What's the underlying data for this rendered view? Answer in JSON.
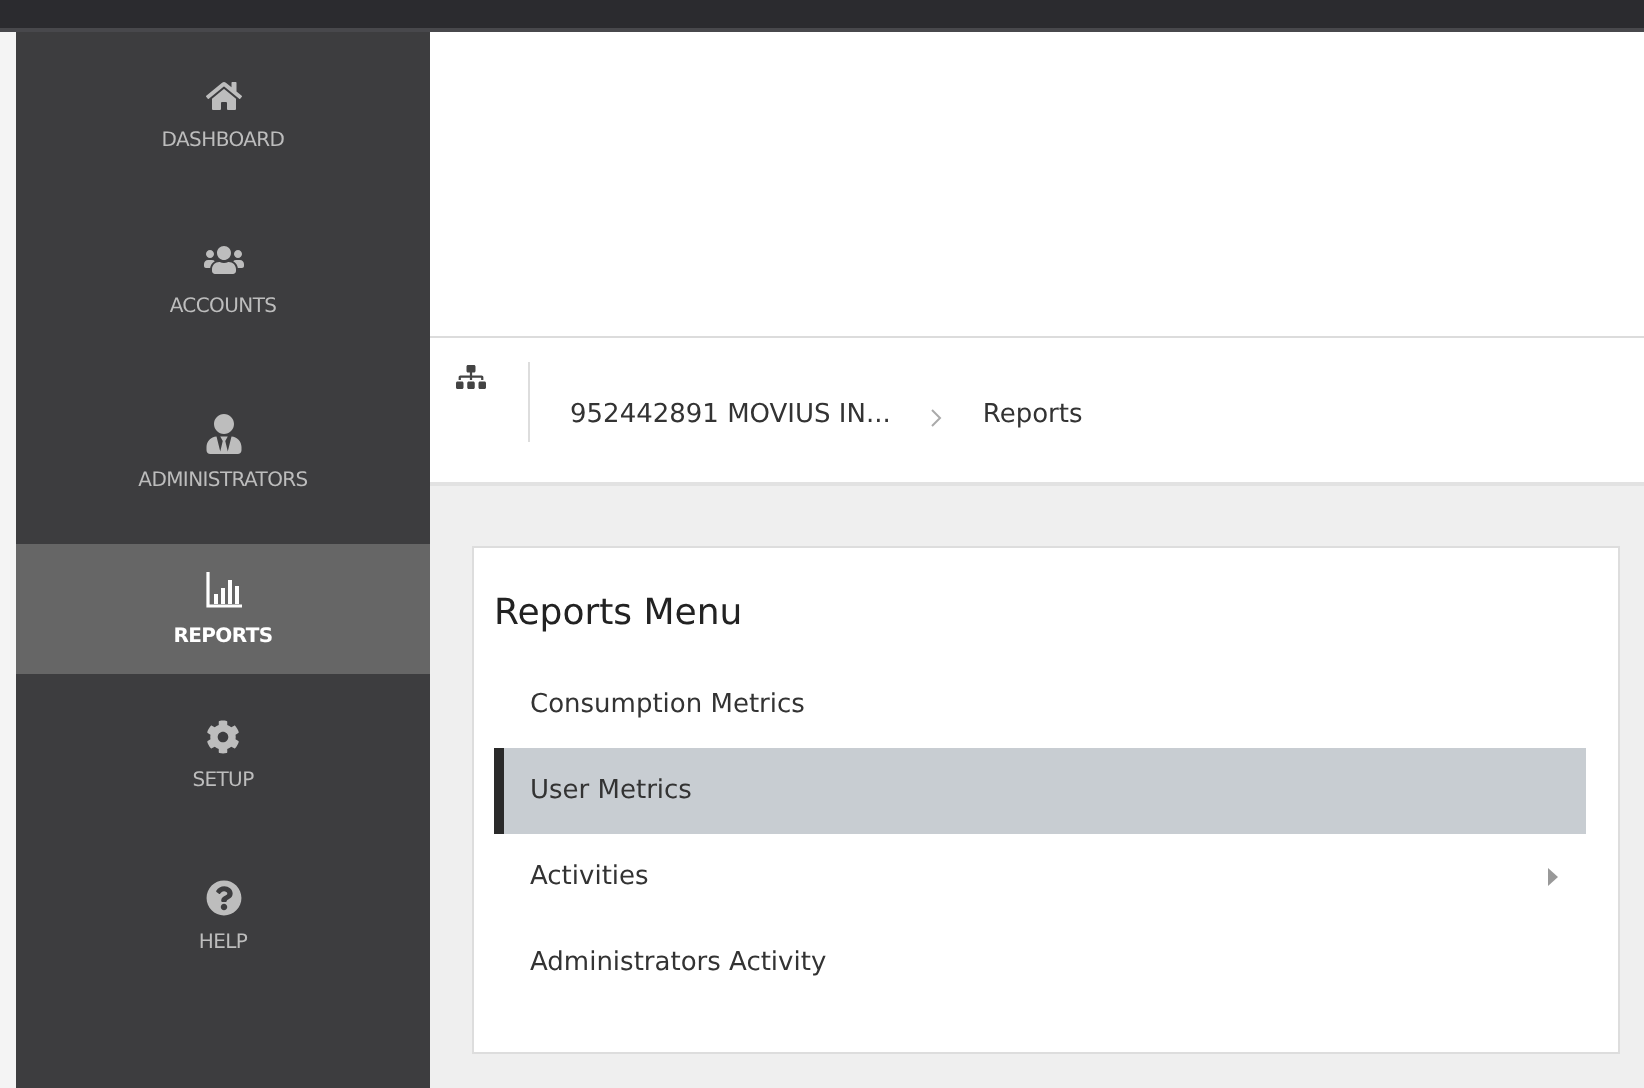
{
  "sidebar": {
    "items": [
      {
        "label": "DASHBOARD",
        "selected": false
      },
      {
        "label": "ACCOUNTS",
        "selected": false
      },
      {
        "label": "ADMINISTRATORS",
        "selected": false
      },
      {
        "label": "REPORTS",
        "selected": true
      },
      {
        "label": "SETUP",
        "selected": false
      },
      {
        "label": "HELP",
        "selected": false
      }
    ]
  },
  "breadcrumb": {
    "items": [
      "952442891 MOVIUS IN...",
      "Reports"
    ]
  },
  "reports_menu": {
    "title": "Reports Menu",
    "items": [
      {
        "label": "Consumption Metrics",
        "selected": false,
        "has_submenu": false
      },
      {
        "label": "User Metrics",
        "selected": true,
        "has_submenu": false
      },
      {
        "label": "Activities",
        "selected": false,
        "has_submenu": true
      },
      {
        "label": "Administrators Activity",
        "selected": false,
        "has_submenu": false
      }
    ]
  }
}
